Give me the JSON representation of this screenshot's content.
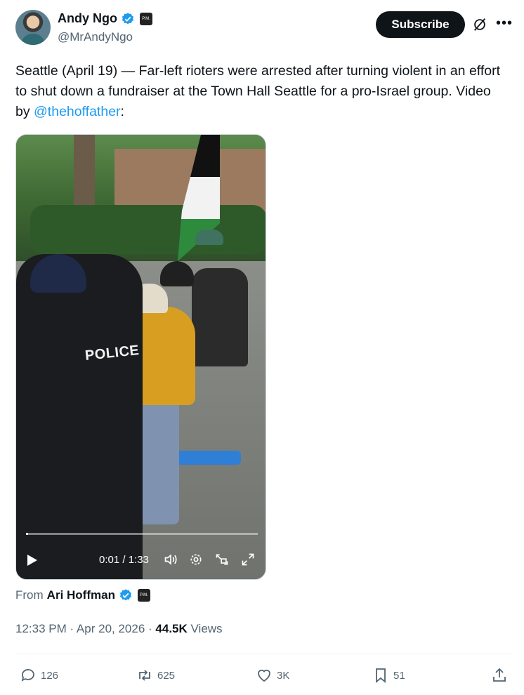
{
  "author": {
    "name": "Andy Ngo",
    "handle": "@MrAndyNgo",
    "affiliate_badge": "P.M."
  },
  "header": {
    "subscribe_label": "Subscribe"
  },
  "tweet": {
    "text_before": "Seattle (April 19) — Far-left rioters were arrested after turning violent in an effort to shut down a fundraiser at the Town Hall Seattle for a pro-Israel group. Video by ",
    "mention": "@thehoffather",
    "text_after": ":"
  },
  "video": {
    "police_vest_text": "POLICE",
    "time": "0:01 / 1:33",
    "progress": 0.01
  },
  "source": {
    "prefix": "From",
    "name": "Ari Hoffman",
    "affiliate_badge": "P.M."
  },
  "meta": {
    "timestamp": "12:33 PM · Apr 20, 2026 · ",
    "views_count": "44.5K",
    "views_label": " Views"
  },
  "actions": {
    "replies": "126",
    "reposts": "625",
    "likes": "3K",
    "bookmarks": "51"
  },
  "colors": {
    "accent": "#1d9bf0",
    "text": "#0f1419",
    "muted": "#536471"
  }
}
